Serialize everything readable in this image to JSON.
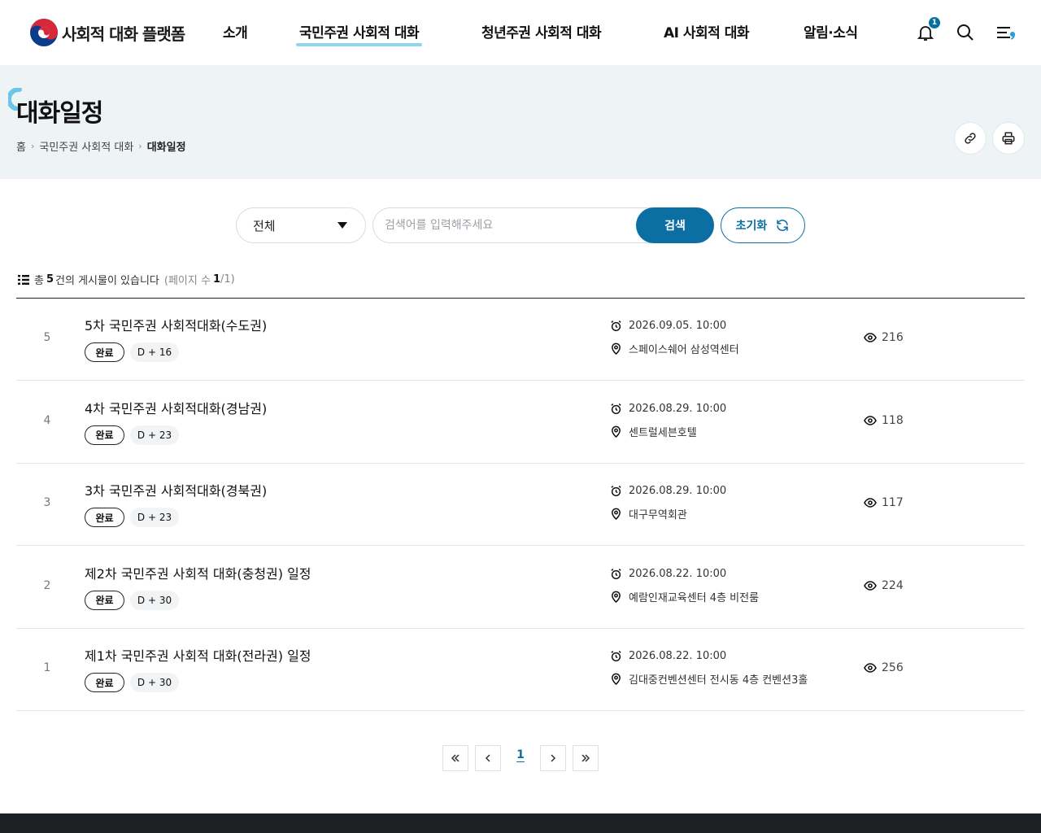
{
  "header": {
    "logo_text": "사회적 대화 플랫폼",
    "nav": [
      "소개",
      "국민주권 사회적 대화",
      "청년주권 사회적 대화",
      "AI 사회적 대화",
      "알림·소식"
    ],
    "notification_count": "1"
  },
  "page": {
    "title": "대화일정",
    "breadcrumb": [
      "홈",
      "국민주권 사회적 대화",
      "대화일정"
    ]
  },
  "search": {
    "category_value": "전체",
    "placeholder": "검색어를 입력해주세요",
    "search_label": "검색",
    "reset_label": "초기화"
  },
  "summary": {
    "prefix": "총",
    "count": "5",
    "suffix": "건의 게시물이 있습니다",
    "page_label": "(페이지 수",
    "page_current": "1",
    "page_total": "/1)"
  },
  "rows": [
    {
      "num": "5",
      "title": "5차 국민주권 사회적대화(수도권)",
      "status": "완료",
      "dday": "D + 16",
      "date": "2026.09.05. 10:00",
      "place": "스페이스쉐어 삼성역센터",
      "views": "216"
    },
    {
      "num": "4",
      "title": "4차 국민주권 사회적대화(경남권)",
      "status": "완료",
      "dday": "D + 23",
      "date": "2026.08.29. 10:00",
      "place": "센트럴세븐호텔",
      "views": "118"
    },
    {
      "num": "3",
      "title": "3차 국민주권 사회적대화(경북권)",
      "status": "완료",
      "dday": "D + 23",
      "date": "2026.08.29. 10:00",
      "place": "대구무역회관",
      "views": "117"
    },
    {
      "num": "2",
      "title": "제2차 국민주권 사회적 대화(충청권) 일정",
      "status": "완료",
      "dday": "D + 30",
      "date": "2026.08.22. 10:00",
      "place": "예람인재교육센터 4층 비전룸",
      "views": "224"
    },
    {
      "num": "1",
      "title": "제1차 국민주권 사회적 대화(전라권) 일정",
      "status": "완료",
      "dday": "D + 30",
      "date": "2026.08.22. 10:00",
      "place": "김대중컨벤션센터 전시동 4층 컨벤션3홀",
      "views": "256"
    }
  ],
  "pagination": {
    "current": "1"
  },
  "colors": {
    "primary": "#0b6fa4",
    "accent": "#8ed6ef",
    "band": "#eef3f6"
  }
}
